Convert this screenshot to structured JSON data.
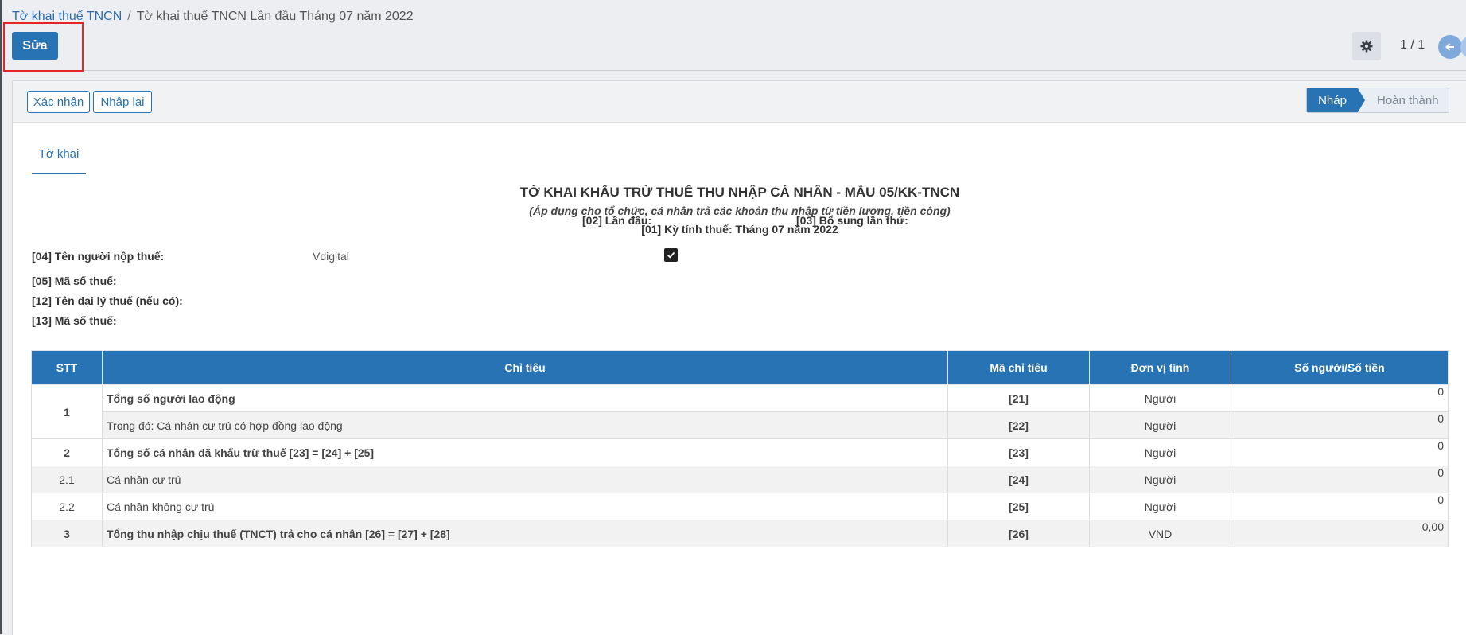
{
  "breadcrumb": {
    "parent": "Tờ khai thuế TNCN",
    "separator": "/",
    "current": "Tờ khai thuế TNCN Lần đầu Tháng 07 năm 2022"
  },
  "toolbar": {
    "edit_label": "Sửa",
    "pager": "1 / 1"
  },
  "statusbar": {
    "confirm_label": "Xác nhận",
    "reset_label": "Nhập lại",
    "stages": [
      "Nháp",
      "Hoàn thành"
    ],
    "active_stage": "Nháp"
  },
  "tabs": [
    "Tờ khai"
  ],
  "form": {
    "title": "TỜ KHAI KHẤU TRỪ THUẾ THU NHẬP CÁ NHÂN - MẪU 05/KK-TNCN",
    "subtitle": "(Áp dụng cho tổ chức, cá nhân trả các khoản thu nhập từ tiền lương, tiền công)",
    "period": "[01] Kỳ tính thuế: Tháng 07 năm 2022",
    "first_time_label": "[02] Lần đầu:",
    "first_time_checked": true,
    "supplement_label": "[03] Bổ sung lần thứ:",
    "taxpayer_name_label": "[04] Tên người nộp thuế:",
    "taxpayer_name_value": "Vdigital",
    "tax_code_label": "[05] Mã số thuế:",
    "agent_name_label": "[12] Tên đại lý thuế (nếu có):",
    "agent_tax_code_label": "[13] Mã số thuế:"
  },
  "table": {
    "headers": [
      "STT",
      "Chỉ tiêu",
      "Mã chỉ tiêu",
      "Đơn vị tính",
      "Số người/Số tiền"
    ],
    "rows": [
      {
        "stt": "1",
        "label": "Tổng số người lao động",
        "code": "[21]",
        "unit": "Người",
        "value": "0"
      },
      {
        "stt": "",
        "label": "Trong đó: Cá nhân cư trú có hợp đồng lao động",
        "code": "[22]",
        "unit": "Người",
        "value": "0"
      },
      {
        "stt": "2",
        "label": "Tổng số cá nhân đã khấu trừ thuế [23] = [24] + [25]",
        "code": "[23]",
        "unit": "Người",
        "value": "0"
      },
      {
        "stt": "2.1",
        "label": "Cá nhân cư trú",
        "code": "[24]",
        "unit": "Người",
        "value": "0"
      },
      {
        "stt": "2.2",
        "label": "Cá nhân không cư trú",
        "code": "[25]",
        "unit": "Người",
        "value": "0"
      },
      {
        "stt": "3",
        "label": "Tổng thu nhập chịu thuế (TNCT) trả cho cá nhân [26] = [27] + [28]",
        "code": "[26]",
        "unit": "VND",
        "value": "0,00"
      }
    ]
  },
  "colors": {
    "primary": "#2873b4",
    "highlight": "#e32525"
  }
}
